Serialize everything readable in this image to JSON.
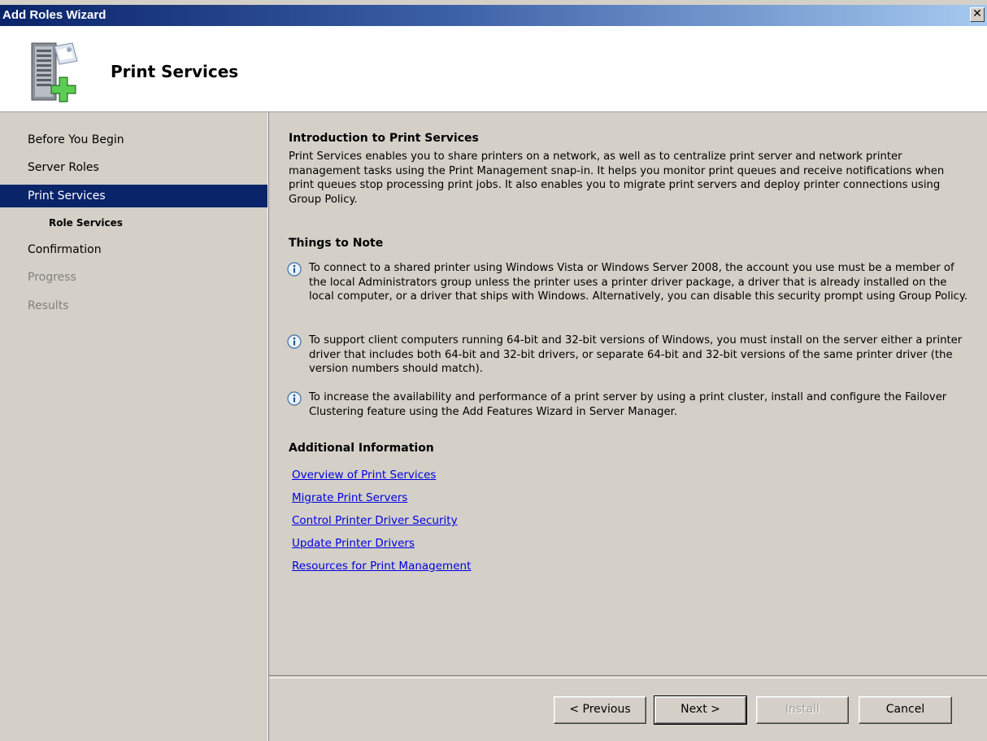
{
  "window": {
    "title": "Add Roles Wizard",
    "close_label": "✕"
  },
  "header": {
    "title": "Print Services",
    "icon": "server-add-icon"
  },
  "nav": {
    "items": [
      {
        "label": "Before You Begin",
        "state": "normal"
      },
      {
        "label": "Server Roles",
        "state": "normal"
      },
      {
        "label": "Print Services",
        "state": "selected"
      },
      {
        "label": "Role Services",
        "state": "sub"
      },
      {
        "label": "Confirmation",
        "state": "normal"
      },
      {
        "label": "Progress",
        "state": "disabled"
      },
      {
        "label": "Results",
        "state": "disabled"
      }
    ]
  },
  "main": {
    "intro_heading": "Introduction to Print Services",
    "intro_text": "Print Services enables you to share printers on a network, as well as to centralize print server and network printer management tasks using the Print Management snap-in. It helps you monitor print queues and receive notifications when print queues stop processing print jobs. It also enables you to migrate print servers and deploy printer connections using Group Policy.",
    "notes_heading": "Things to Note",
    "notes": [
      "To connect to a shared printer using Windows Vista or Windows Server 2008, the account you use must be a member of the local Administrators group unless the printer uses a printer driver package, a driver that is already installed on the local computer, or a driver that ships with Windows. Alternatively, you can disable this security prompt using Group Policy.",
      "To support client computers running 64-bit and 32-bit versions of Windows, you must install on the server either a printer driver that includes both 64-bit and 32-bit drivers, or separate 64-bit and 32-bit versions of the same printer driver (the version numbers should match).",
      "To increase the availability and performance of a print server by using a print cluster, install and configure the Failover Clustering feature using the Add Features Wizard in Server Manager."
    ],
    "additional_heading": "Additional Information",
    "links": [
      "Overview of Print Services",
      "Migrate Print Servers",
      "Control Printer Driver Security",
      "Update Printer Drivers",
      "Resources for Print Management"
    ]
  },
  "buttons": {
    "previous": "< Previous",
    "next": "Next >",
    "install": "Install",
    "cancel": "Cancel"
  },
  "colors": {
    "title_start": "#0a246a",
    "title_end": "#a6caf0",
    "selected_bg": "#0a246a",
    "link": "#0000e0",
    "info_icon": "#3a6ea5"
  }
}
